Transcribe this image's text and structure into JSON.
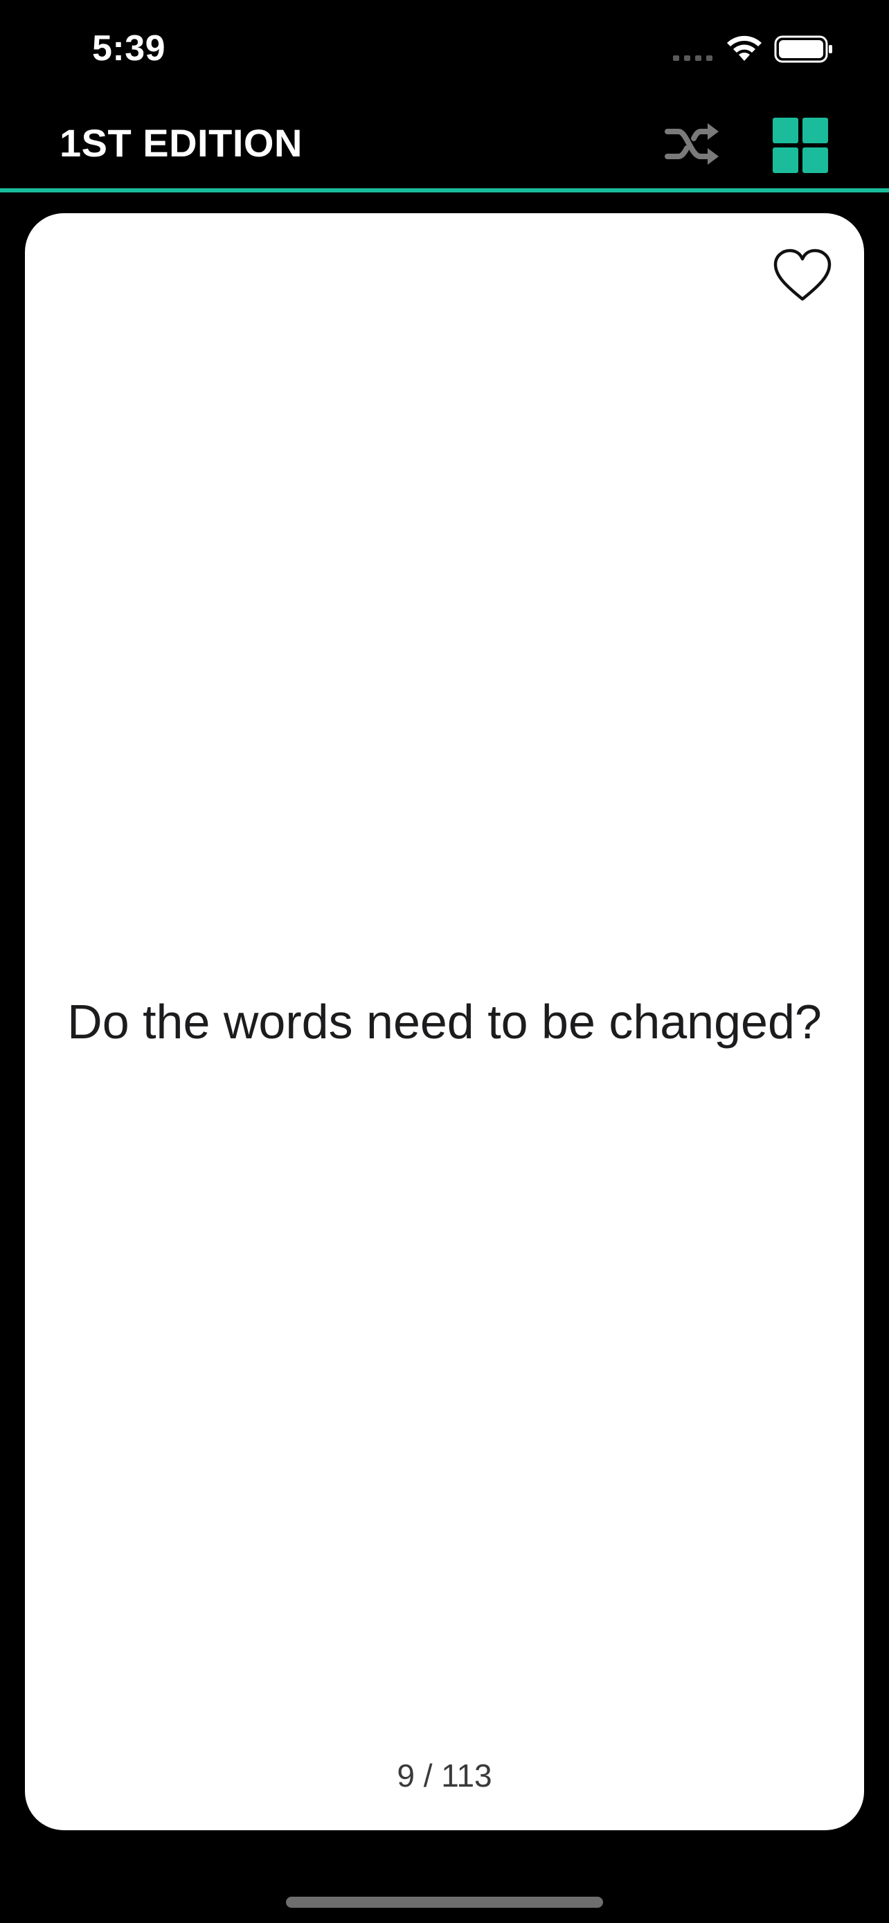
{
  "status_bar": {
    "time": "5:39"
  },
  "nav": {
    "title": "1ST EDITION",
    "shuffle_icon": "shuffle-icon",
    "grid_icon": "grid-icon"
  },
  "card": {
    "question": "Do the words need to be changed?",
    "counter": "9 / 113",
    "favorite_icon": "heart-outline-icon"
  },
  "colors": {
    "background": "#000000",
    "accent": "#1ABC9C",
    "card": "#FFFFFF",
    "text_dark": "#1C1C1E",
    "icon_gray": "#7A7A7A"
  }
}
